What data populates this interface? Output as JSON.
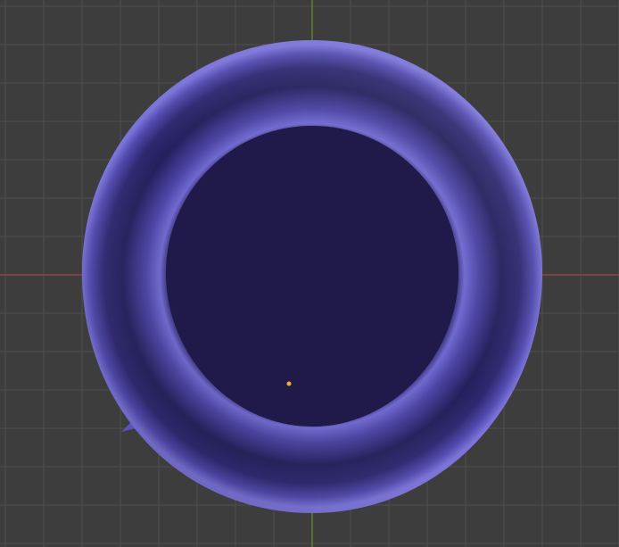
{
  "viewport": {
    "view": "top",
    "grid": true,
    "colors": {
      "background": "#3d3d3d",
      "grid_minor": "#444444",
      "grid_major": "#4f4f4f",
      "x_axis": "#a3424d",
      "y_axis": "#6b8f2b",
      "object_fill_inner": "#1f1a4a",
      "object_edge_light": "#6b64c8",
      "object_edge_dark": "#1c1845",
      "origin": "#f7a45a"
    },
    "object": {
      "shape": "torus",
      "selected": false
    }
  }
}
